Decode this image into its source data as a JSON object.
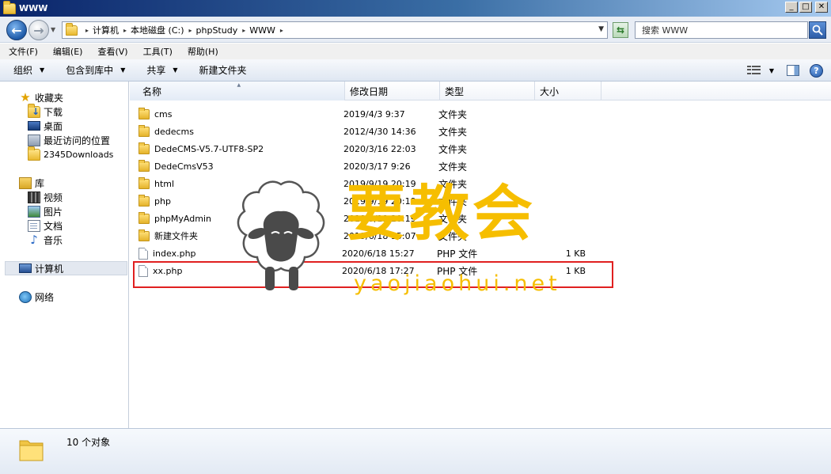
{
  "window": {
    "title": "WWW"
  },
  "address": {
    "crumbs": [
      "计算机",
      "本地磁盘 (C:)",
      "phpStudy",
      "WWW"
    ]
  },
  "search": {
    "placeholder": "搜索 WWW"
  },
  "menu": [
    "文件(F)",
    "编辑(E)",
    "查看(V)",
    "工具(T)",
    "帮助(H)"
  ],
  "toolbar": {
    "organize": "组织",
    "include_library": "包含到库中",
    "share": "共享",
    "new_folder": "新建文件夹"
  },
  "nav": {
    "favorites": "收藏夹",
    "downloads": "下载",
    "desktop": "桌面",
    "recent": "最近访问的位置",
    "downloads2345": "2345Downloads",
    "libraries": "库",
    "videos": "视频",
    "pictures": "图片",
    "documents": "文档",
    "music": "音乐",
    "computer": "计算机",
    "network": "网络"
  },
  "columns": {
    "name": "名称",
    "date": "修改日期",
    "type": "类型",
    "size": "大小"
  },
  "files": [
    {
      "name": "cms",
      "date": "2019/4/3 9:37",
      "type": "文件夹",
      "size": "",
      "kind": "folder"
    },
    {
      "name": "dedecms",
      "date": "2012/4/30 14:36",
      "type": "文件夹",
      "size": "",
      "kind": "folder"
    },
    {
      "name": "DedeCMS-V5.7-UTF8-SP2",
      "date": "2020/3/16 22:03",
      "type": "文件夹",
      "size": "",
      "kind": "folder"
    },
    {
      "name": "DedeCmsV53",
      "date": "2020/3/17 9:26",
      "type": "文件夹",
      "size": "",
      "kind": "folder"
    },
    {
      "name": "html",
      "date": "2019/9/19 20:19",
      "type": "文件夹",
      "size": "",
      "kind": "folder"
    },
    {
      "name": "php",
      "date": "2019/9/19 20:19",
      "type": "文件夹",
      "size": "",
      "kind": "folder"
    },
    {
      "name": "phpMyAdmin",
      "date": "2019/9/19 20:19",
      "type": "文件夹",
      "size": "",
      "kind": "folder"
    },
    {
      "name": "新建文件夹",
      "date": "2019/6/18 15:07",
      "type": "文件夹",
      "size": "",
      "kind": "folder"
    },
    {
      "name": "index.php",
      "date": "2020/6/18 15:27",
      "type": "PHP 文件",
      "size": "1 KB",
      "kind": "file"
    },
    {
      "name": "xx.php",
      "date": "2020/6/18 17:27",
      "type": "PHP 文件",
      "size": "1 KB",
      "kind": "file"
    }
  ],
  "details": {
    "count": "10 个对象"
  },
  "watermark": {
    "cn": "要教会",
    "en": "yaojiaohui.net"
  },
  "colors": {
    "accent": "#3a6ea5",
    "highlight": "#e02020",
    "watermark": "#f6be00"
  }
}
